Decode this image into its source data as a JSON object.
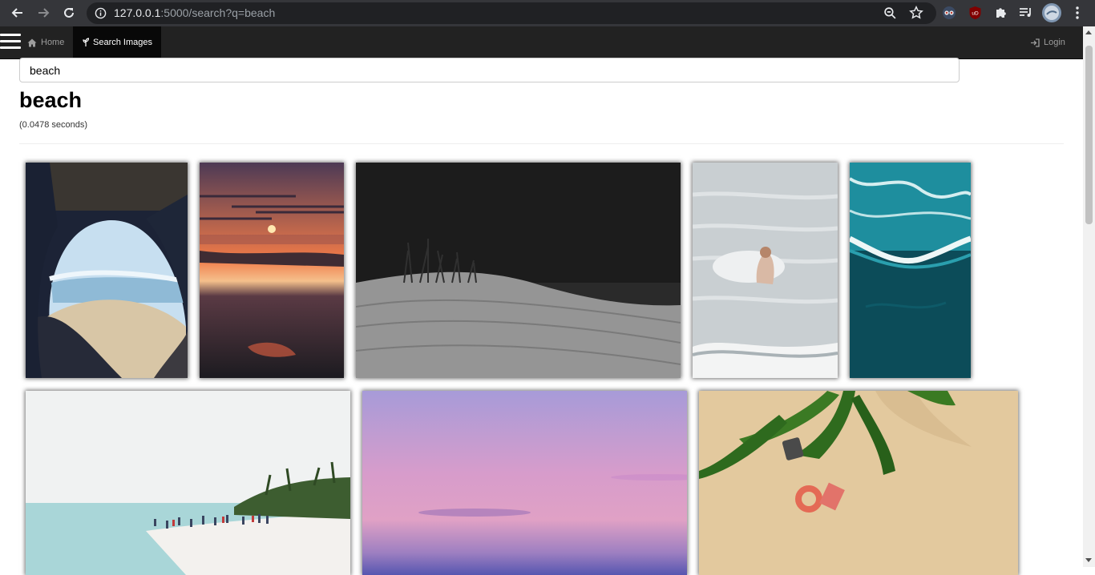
{
  "browser": {
    "url_host": "127.0.0.1",
    "url_rest": ":5000/search?q=beach",
    "back_icon": "back-arrow-icon",
    "forward_icon": "forward-arrow-icon",
    "reload_icon": "reload-icon",
    "info_icon": "info-icon",
    "zoom_icon": "zoom-icon",
    "star_icon": "bookmark-star-icon",
    "extensions": [
      "spy-glasses-extension-icon",
      "ublock-extension-icon",
      "puzzle-extensions-icon",
      "media-queue-icon"
    ],
    "ublock_label": "uD"
  },
  "navbar": {
    "home_label": "Home",
    "search_label": "Search Images",
    "login_label": "Login"
  },
  "search": {
    "value": "beach"
  },
  "results": {
    "heading": "beach",
    "timing": "(0.0478 seconds)",
    "images": [
      {
        "name": "sea-cave-arch-image",
        "palette": [
          "#1b2234",
          "#8ab8d8",
          "#d7c6ab"
        ]
      },
      {
        "name": "orange-sunset-image",
        "palette": [
          "#6a3a3c",
          "#f27b4a",
          "#1f1e22"
        ]
      },
      {
        "name": "dark-sand-dune-image",
        "palette": [
          "#1b1b1b",
          "#9b9b9b",
          "#3a3a3a"
        ]
      },
      {
        "name": "swimmer-waves-image",
        "palette": [
          "#cfd4d6",
          "#9aa4a8",
          "#e8e9ea"
        ]
      },
      {
        "name": "aerial-turquoise-sea-image",
        "palette": [
          "#0b4b58",
          "#1f8f9f",
          "#e9f2f2"
        ]
      },
      {
        "name": "crowded-shoreline-image",
        "palette": [
          "#f2f3f3",
          "#aad6d8",
          "#3f5c32"
        ]
      },
      {
        "name": "purple-pink-sky-image",
        "palette": [
          "#a89bd6",
          "#e0a0c8",
          "#5b5ab0"
        ]
      },
      {
        "name": "palm-beach-aerial-image",
        "palette": [
          "#e4cba0",
          "#2f6a1e",
          "#e0735e"
        ]
      }
    ]
  }
}
